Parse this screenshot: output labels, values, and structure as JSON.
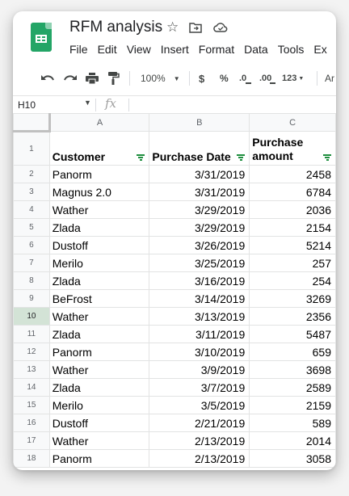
{
  "app": {
    "title": "RFM analysis",
    "menu": [
      "File",
      "Edit",
      "View",
      "Insert",
      "Format",
      "Data",
      "Tools",
      "Ex"
    ]
  },
  "toolbar": {
    "zoom": "100%",
    "currency": "$",
    "percent": "%",
    "dec_decrease": ".0",
    "dec_increase": ".00",
    "number_format": "123",
    "font_partial": "Ar"
  },
  "formula_bar": {
    "name_box": "H10",
    "fx_label": "fx"
  },
  "sheet": {
    "columns": [
      "A",
      "B",
      "C"
    ],
    "selected_row": "10",
    "headers": {
      "customer": "Customer",
      "purchase_date": "Purchase Date",
      "purchase_amount_line1": "Purchase",
      "purchase_amount_line2": "amount"
    },
    "header_row_number": "1",
    "rows": [
      {
        "n": "2",
        "customer": "Panorm",
        "date": "3/31/2019",
        "amount": "2458"
      },
      {
        "n": "3",
        "customer": "Magnus 2.0",
        "date": "3/31/2019",
        "amount": "6784"
      },
      {
        "n": "4",
        "customer": "Wather",
        "date": "3/29/2019",
        "amount": "2036"
      },
      {
        "n": "5",
        "customer": "Zlada",
        "date": "3/29/2019",
        "amount": "2154"
      },
      {
        "n": "6",
        "customer": "Dustoff",
        "date": "3/26/2019",
        "amount": "5214"
      },
      {
        "n": "7",
        "customer": "Merilo",
        "date": "3/25/2019",
        "amount": "257"
      },
      {
        "n": "8",
        "customer": "Zlada",
        "date": "3/16/2019",
        "amount": "254"
      },
      {
        "n": "9",
        "customer": "BeFrost",
        "date": "3/14/2019",
        "amount": "3269"
      },
      {
        "n": "10",
        "customer": "Wather",
        "date": "3/13/2019",
        "amount": "2356"
      },
      {
        "n": "11",
        "customer": "Zlada",
        "date": "3/11/2019",
        "amount": "5487"
      },
      {
        "n": "12",
        "customer": "Panorm",
        "date": "3/10/2019",
        "amount": "659"
      },
      {
        "n": "13",
        "customer": "Wather",
        "date": "3/9/2019",
        "amount": "3698"
      },
      {
        "n": "14",
        "customer": "Zlada",
        "date": "3/7/2019",
        "amount": "2589"
      },
      {
        "n": "15",
        "customer": "Merilo",
        "date": "3/5/2019",
        "amount": "2159"
      },
      {
        "n": "16",
        "customer": "Dustoff",
        "date": "2/21/2019",
        "amount": "589"
      },
      {
        "n": "17",
        "customer": "Wather",
        "date": "2/13/2019",
        "amount": "2014"
      },
      {
        "n": "18",
        "customer": "Panorm",
        "date": "2/13/2019",
        "amount": "3058"
      }
    ]
  },
  "colors": {
    "brand": "#23a566",
    "filter": "#1e8e3e",
    "selected_row_header": "#d3e3d6"
  }
}
